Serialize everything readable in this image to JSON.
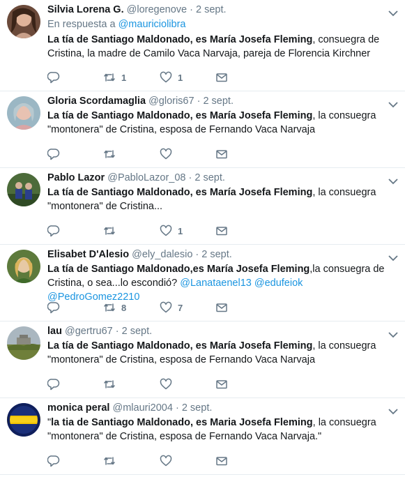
{
  "tweets": [
    {
      "name": "Silvia Lorena G.",
      "handle": "@loregenove",
      "date": "· 2 sept.",
      "reply_prefix": "En respuesta a",
      "reply_to": "@mauriciolibra",
      "bold": "La tía de Santiago Maldonado, es María Josefa Fleming",
      "rest": ", consuegra de Cristina, la madre de Camilo Vaca Narvaja, pareja de Florencia Kirchner",
      "retweets": "1",
      "likes": "1"
    },
    {
      "name": "Gloria Scordamaglia",
      "handle": "@gloris67",
      "date": "· 2 sept.",
      "bold": "La tía de Santiago Maldonado, es María Josefa Fleming",
      "rest": ", la consuegra \"montonera\" de Cristina, esposa de Fernando Vaca Narvaja",
      "retweets": "",
      "likes": ""
    },
    {
      "name": "Pablo Lazor",
      "handle": "@PabloLazor_08",
      "date": "· 2 sept.",
      "bold": "La tía de Santiago Maldonado, es María Josefa Fleming",
      "rest": ", la consuegra \"montonera\" de Cristina...",
      "retweets": "",
      "likes": "1"
    },
    {
      "name": "Elisabet D'Alesio",
      "handle": "@ely_dalesio",
      "date": "· 2 sept.",
      "bold": "La tía de Santiago Maldonado,es María Josefa Fleming",
      "rest": ",la consuegra de Cristina, o sea...lo escondió? ",
      "mentions": "@Lanataenel13 @edufeiok @PedroGomez2210",
      "retweets": "8",
      "likes": "7"
    },
    {
      "name": "lau",
      "handle": "@gertru67",
      "date": "· 2 sept.",
      "bold": "La tía de Santiago Maldonado, es María Josefa Fleming",
      "rest": ", la consuegra \"montonera\" de Cristina, esposa de Fernando Vaca Narvaja",
      "retweets": "",
      "likes": ""
    },
    {
      "name": "monica peral",
      "handle": "@mlauri2004",
      "date": "· 2 sept.",
      "pre": "\"",
      "bold": "la tia de Santiago Maldonado, es Maria Josefa Fleming",
      "rest": ", la consuegra \"montonera\" de Cristina, esposa de Fernando Vaca Narvaja.\"",
      "retweets": "",
      "likes": ""
    }
  ]
}
